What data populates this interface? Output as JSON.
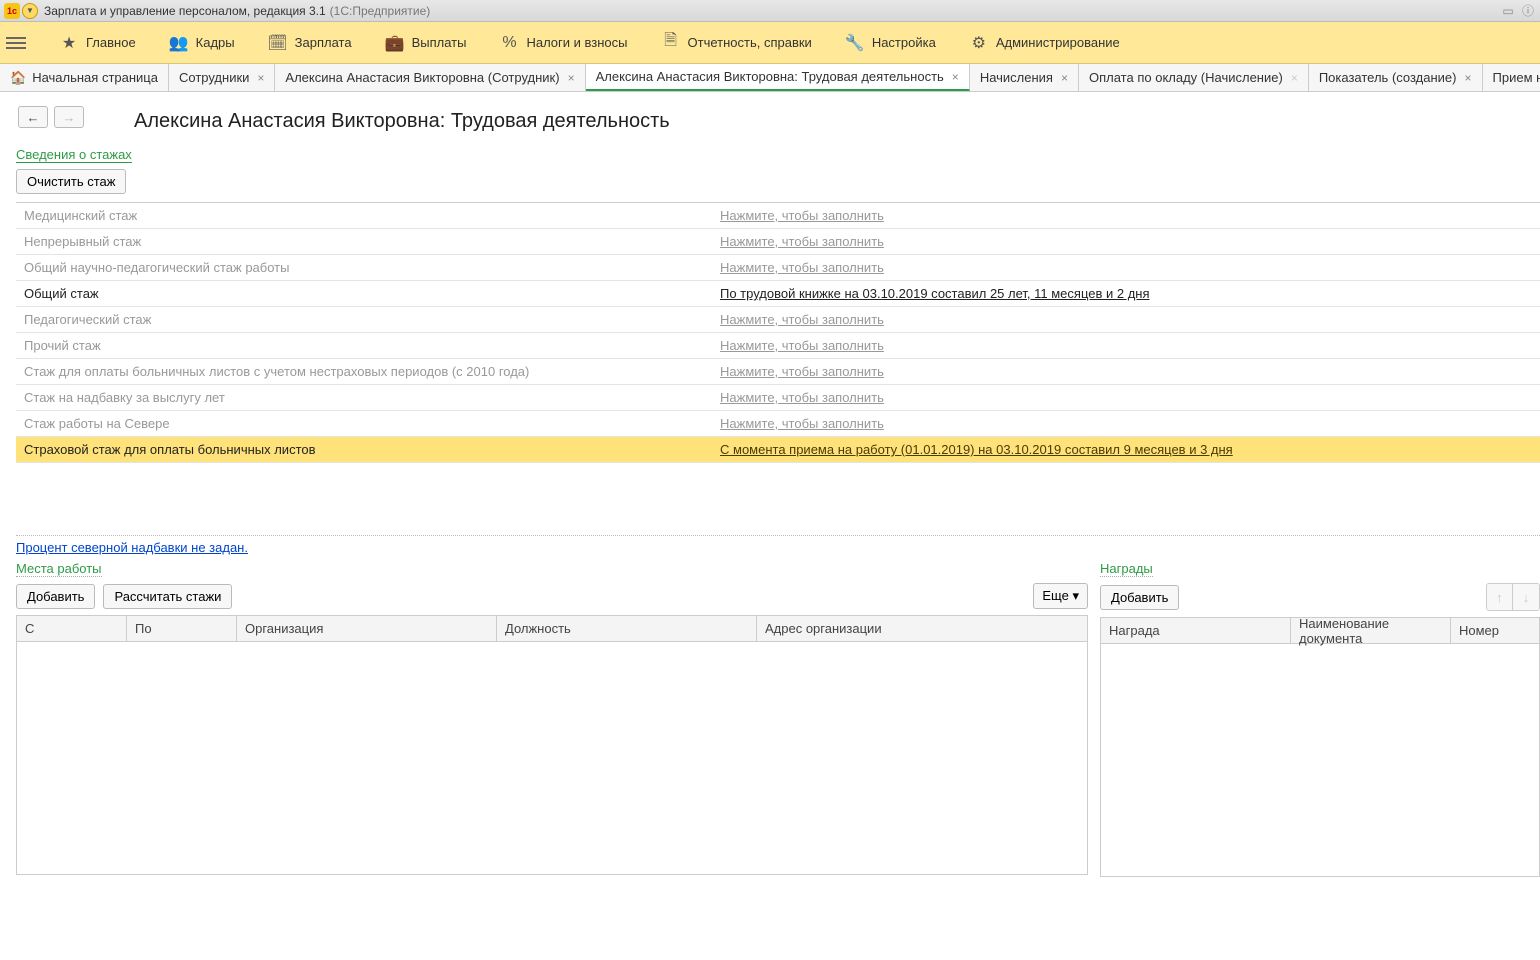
{
  "titlebar": {
    "app_name": "Зарплата и управление персоналом, редакция 3.1",
    "platform": "(1С:Предприятие)",
    "logo_text": "1c"
  },
  "mainnav": {
    "items": [
      {
        "label": "Главное",
        "icon": "star"
      },
      {
        "label": "Кадры",
        "icon": "people"
      },
      {
        "label": "Зарплата",
        "icon": "calc"
      },
      {
        "label": "Выплаты",
        "icon": "wallet"
      },
      {
        "label": "Налоги и взносы",
        "icon": "percent"
      },
      {
        "label": "Отчетность, справки",
        "icon": "doc"
      },
      {
        "label": "Настройка",
        "icon": "wrench"
      },
      {
        "label": "Администрирование",
        "icon": "gear"
      }
    ]
  },
  "tabs": [
    {
      "label": "Начальная страница",
      "home": true,
      "closable": false
    },
    {
      "label": "Сотрудники",
      "closable": true
    },
    {
      "label": "Алексина Анастасия Викторовна (Сотрудник)",
      "closable": true
    },
    {
      "label": "Алексина Анастасия Викторовна: Трудовая деятельность",
      "closable": true,
      "active": true
    },
    {
      "label": "Начисления",
      "closable": true
    },
    {
      "label": "Оплата по окладу (Начисление)",
      "closable": true,
      "faint_close": true
    },
    {
      "label": "Показатель (создание)",
      "closable": true
    },
    {
      "label": "Прием на",
      "closable": false
    }
  ],
  "page": {
    "title": "Алексина Анастасия Викторовна: Трудовая деятельность",
    "section_stazh": "Сведения о стажах",
    "clear_btn": "Очистить стаж",
    "fill_hint": "Нажмите, чтобы заполнить",
    "north_link": "Процент северной надбавки не задан."
  },
  "stazh_rows": [
    {
      "label": "Медицинский стаж",
      "value": null
    },
    {
      "label": "Непрерывный стаж",
      "value": null
    },
    {
      "label": "Общий научно-педагогический стаж работы",
      "value": null
    },
    {
      "label": "Общий стаж",
      "value": "По трудовой книжке на 03.10.2019 составил 25 лет, 11 месяцев и 2 дня",
      "filled": true
    },
    {
      "label": "Педагогический стаж",
      "value": null
    },
    {
      "label": "Прочий стаж",
      "value": null
    },
    {
      "label": "Стаж для оплаты больничных листов с учетом нестраховых периодов (с 2010 года)",
      "value": null
    },
    {
      "label": "Стаж на надбавку за выслугу лет",
      "value": null
    },
    {
      "label": "Стаж работы на Севере",
      "value": null
    },
    {
      "label": "Страховой стаж для оплаты больничных листов",
      "value": "С момента приема на работу (01.01.2019) на 03.10.2019 составил 9 месяцев и 3 дня",
      "filled": true,
      "highlight": true
    }
  ],
  "workplaces": {
    "section": "Места работы",
    "add_btn": "Добавить",
    "calc_btn": "Рассчитать стажи",
    "more_btn": "Еще",
    "columns": [
      "С",
      "По",
      "Организация",
      "Должность",
      "Адрес организации"
    ]
  },
  "awards": {
    "section": "Награды",
    "add_btn": "Добавить",
    "columns": [
      "Награда",
      "Наименование документа",
      "Номер"
    ]
  }
}
